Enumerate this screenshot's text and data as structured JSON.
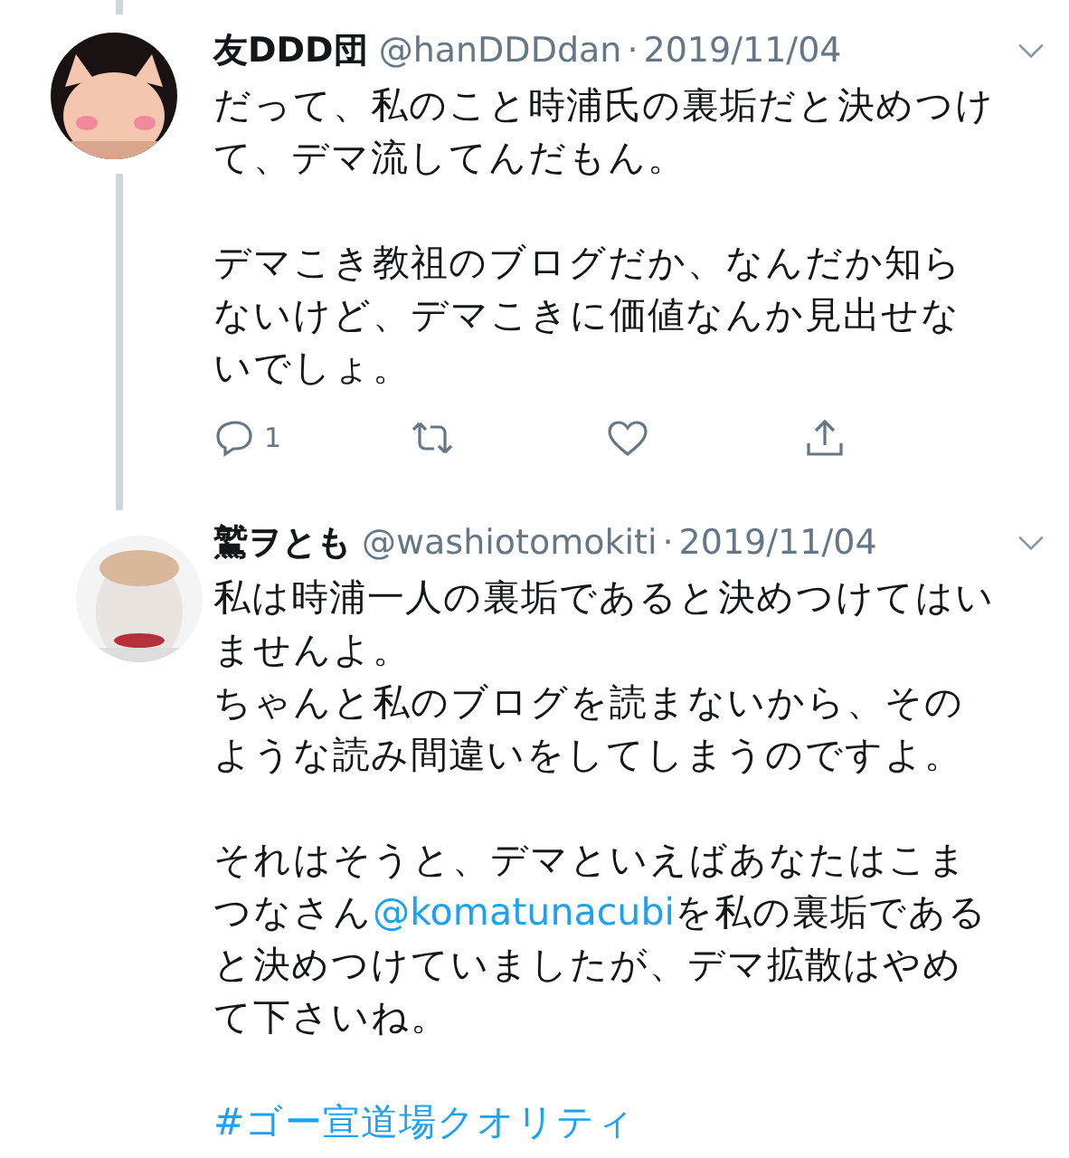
{
  "tweets": [
    {
      "name": "友DDD団",
      "handle": "@hanDDDdan",
      "separator": "·",
      "date": "2019/11/04",
      "thread_above": true,
      "thread_below": true,
      "paragraphs": [
        {
          "lines": [
            [
              {
                "kind": "text",
                "text": "だって、私のこと時浦氏の裏垢だと決めつけて、デマ流してんだもん。"
              }
            ]
          ]
        },
        {
          "lines": [
            [
              {
                "kind": "text",
                "text": "デマこき教祖のブログだか、なんだか知らないけど、デマこきに価値なんか見出せないでしょ。"
              }
            ]
          ]
        }
      ],
      "actions": {
        "reply_count": "1"
      }
    },
    {
      "name": "鷲ヲとも",
      "handle": "@washiotomokiti",
      "separator": "·",
      "date": "2019/11/04",
      "paragraphs": [
        {
          "lines": [
            [
              {
                "kind": "text",
                "text": "私は時浦一人の裏垢であると決めつけてはいませんよ。"
              }
            ],
            [
              {
                "kind": "text",
                "text": "ちゃんと私のブログを読まないから、そのような読み間違いをしてしまうのですよ。"
              }
            ]
          ]
        },
        {
          "lines": [
            [
              {
                "kind": "text",
                "text": "それはそうと、デマといえばあなたはこまつなさん"
              },
              {
                "kind": "mention",
                "text": "@komatunacubi"
              },
              {
                "kind": "text",
                "text": "を私の裏垢であると決めつけていましたが、デマ拡散はやめて下さいね。"
              }
            ]
          ]
        },
        {
          "lines": [
            [
              {
                "kind": "hashtag",
                "text": "#ゴー宣道場クオリティ"
              }
            ]
          ]
        }
      ]
    }
  ]
}
